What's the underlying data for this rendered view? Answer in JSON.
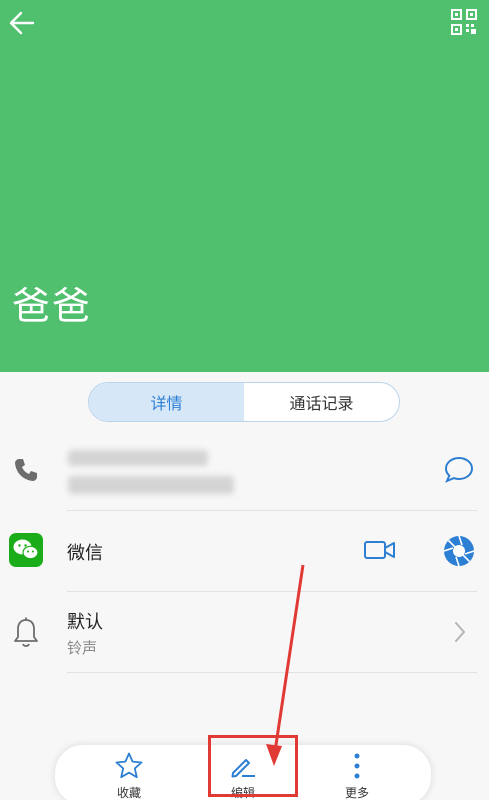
{
  "header": {
    "contact_name": "爸爸",
    "background_color": "#50bf6e",
    "back_icon": "arrow-left-icon",
    "qr_icon": "qr-code-icon"
  },
  "tabs": [
    {
      "label": "详情",
      "active": true
    },
    {
      "label": "通话记录",
      "active": false
    }
  ],
  "rows": {
    "phone": {
      "icon": "phone-icon",
      "action_icon": "message-bubble-icon"
    },
    "wechat": {
      "icon": "wechat-icon",
      "title": "微信",
      "action_icons": [
        "video-camera-icon",
        "shutter-icon"
      ]
    },
    "ringtone": {
      "icon": "bell-icon",
      "title": "默认",
      "subtitle": "铃声",
      "action_icon": "chevron-right-icon"
    }
  },
  "bottom_bar": {
    "items": [
      {
        "label": "收藏",
        "icon": "star-icon"
      },
      {
        "label": "编辑",
        "icon": "pencil-icon"
      },
      {
        "label": "更多",
        "icon": "more-vertical-icon"
      }
    ]
  },
  "annotation": {
    "color": "#e13a34"
  },
  "colors": {
    "accent": "#2d7fd3",
    "wechat_green": "#1aad19"
  }
}
